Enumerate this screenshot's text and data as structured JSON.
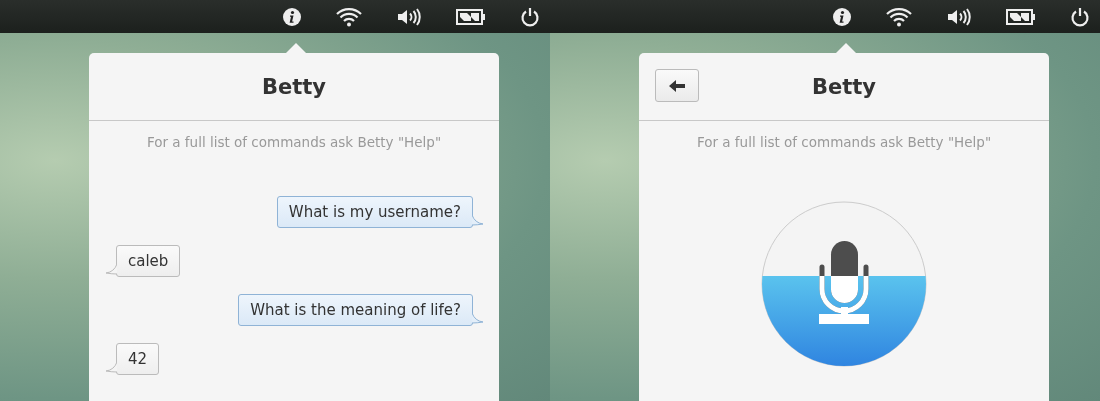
{
  "panels": [
    {
      "header": {
        "title": "Betty",
        "back_button": false
      },
      "hint": "For a full list of commands ask Betty \"Help\"",
      "view": {
        "kind": "chat",
        "messages": [
          {
            "kind": "question",
            "text": "What is my username?"
          },
          {
            "kind": "answer",
            "text": "caleb"
          },
          {
            "kind": "question",
            "text": "What is the meaning of life?"
          },
          {
            "kind": "answer",
            "text": "42"
          }
        ]
      }
    },
    {
      "header": {
        "title": "Betty",
        "back_button": true
      },
      "hint": "For a full list of commands ask Betty \"Help\"",
      "view": {
        "kind": "listening"
      }
    }
  ]
}
